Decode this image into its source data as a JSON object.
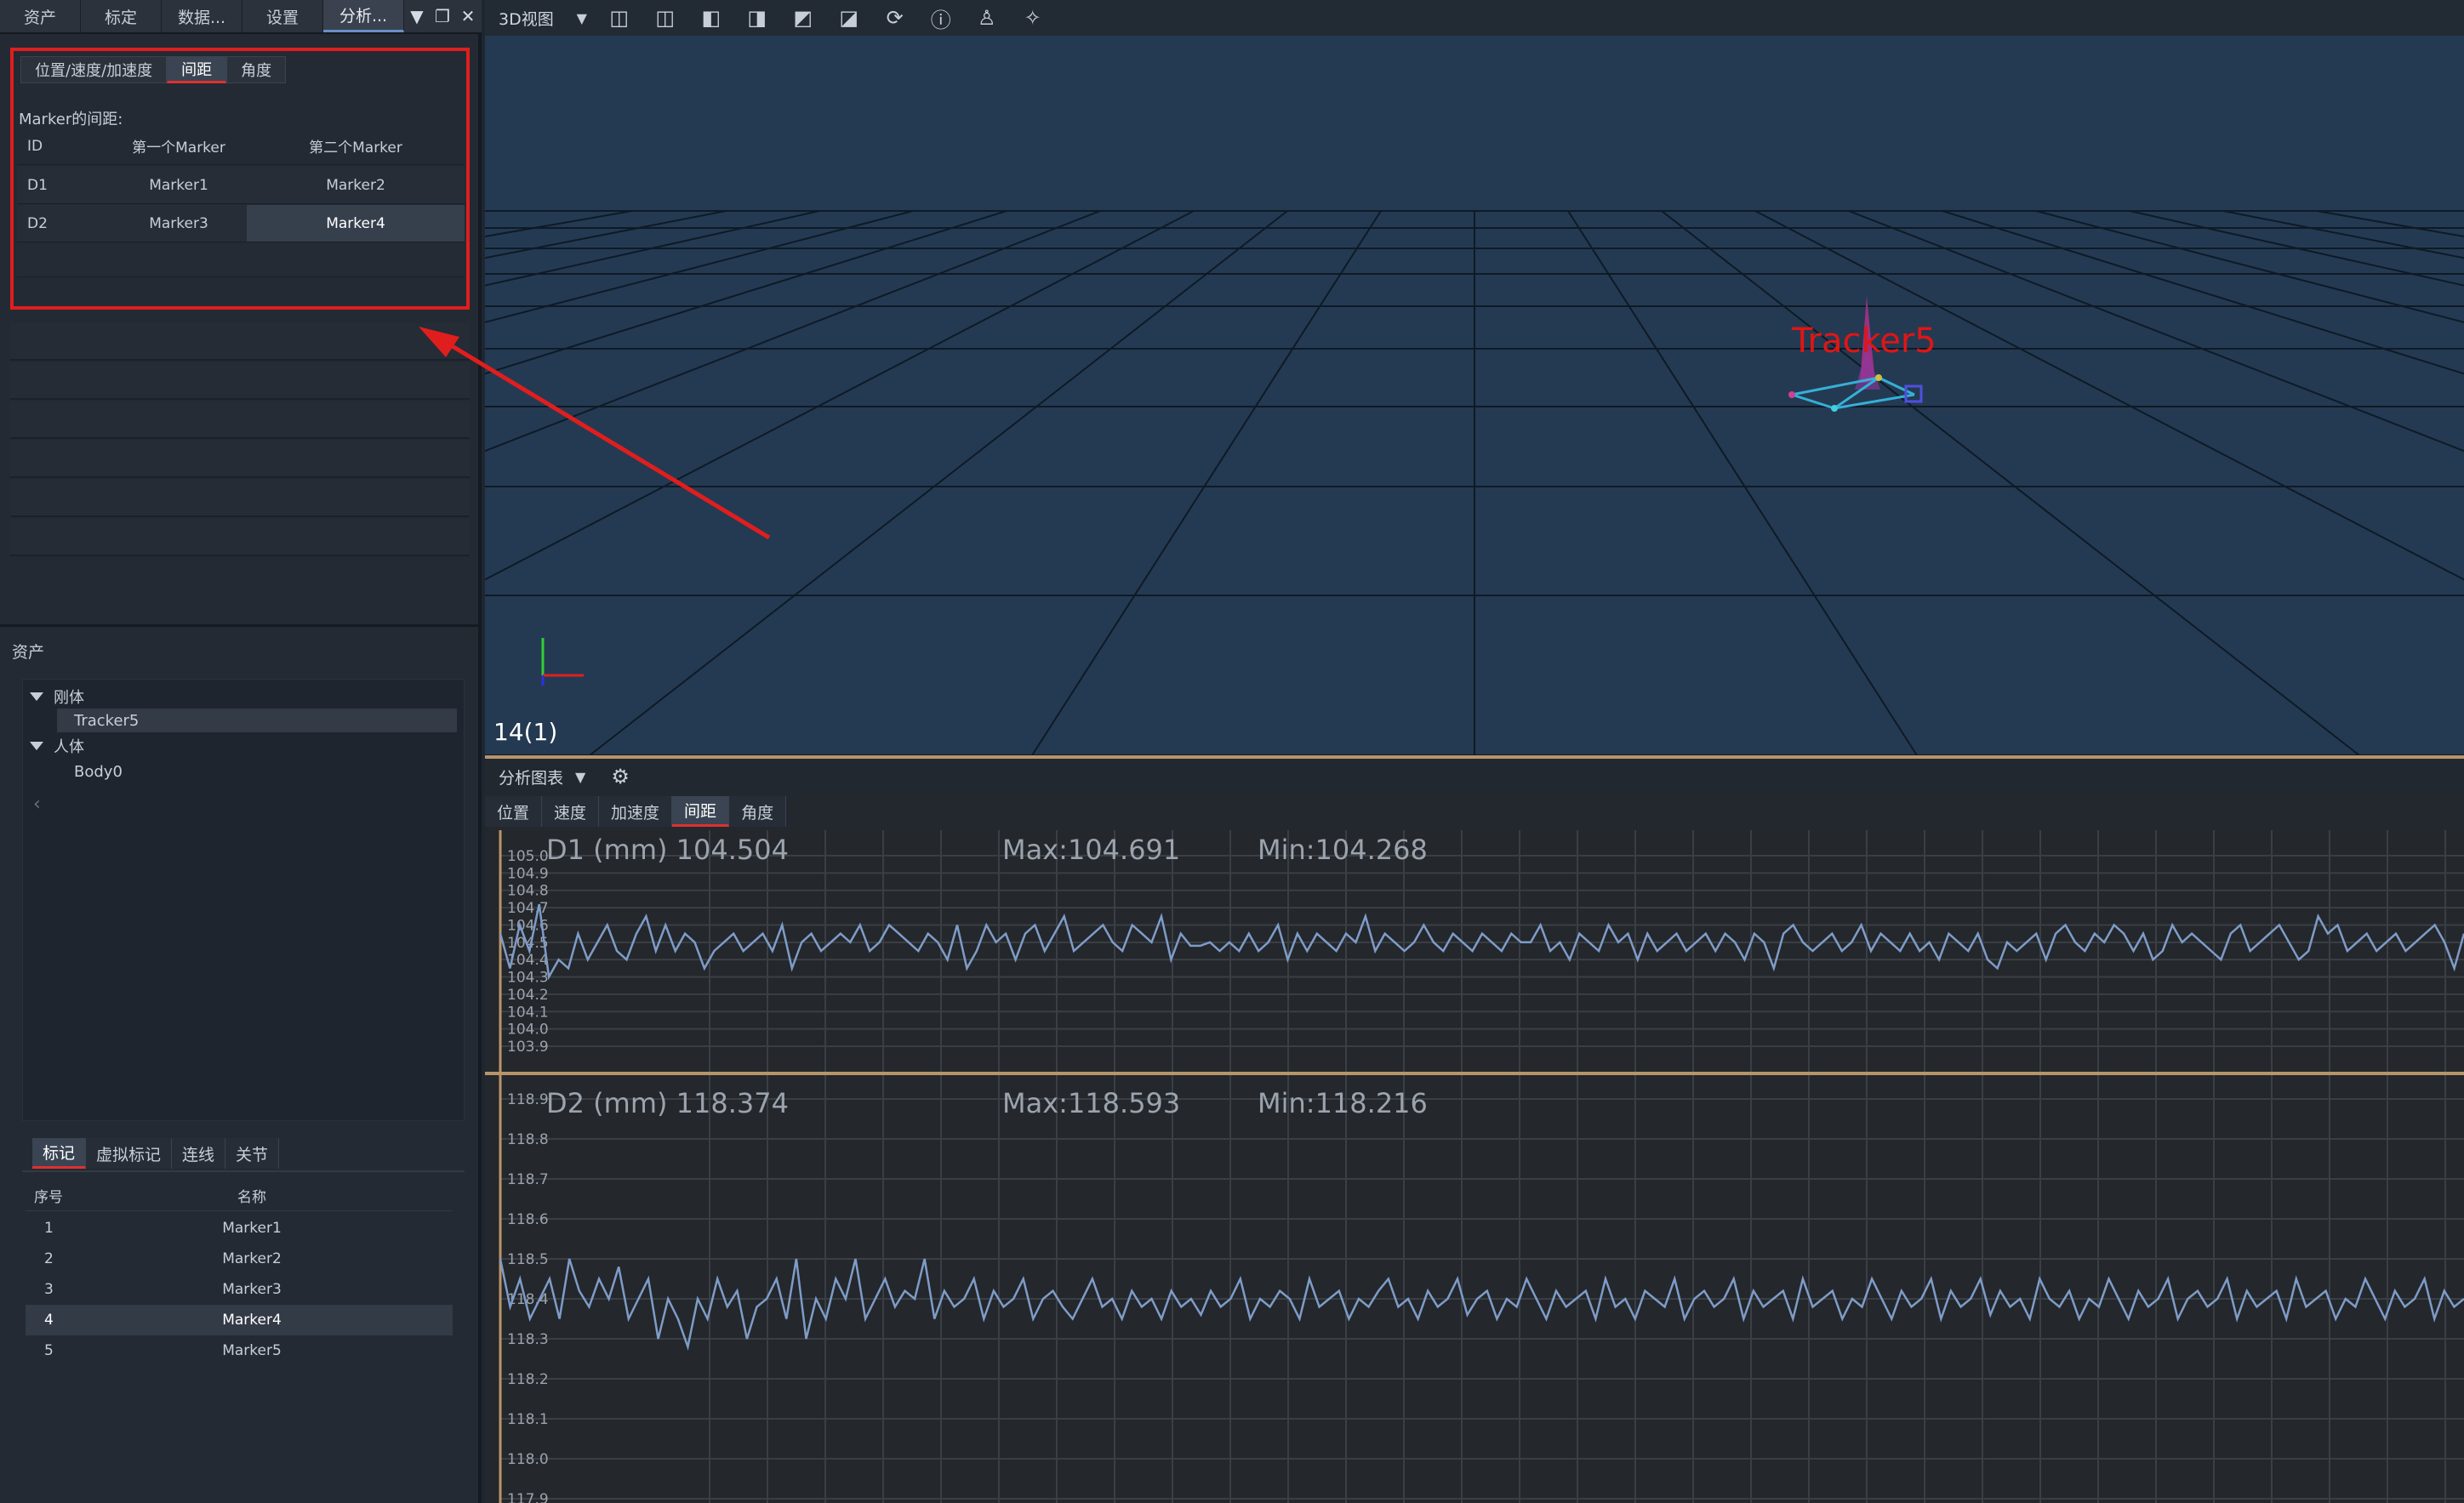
{
  "topTabs": [
    "资产",
    "标定",
    "数据...",
    "设置",
    "分析..."
  ],
  "analysis": {
    "tabs": [
      "位置/速度/加速度",
      "间距",
      "角度"
    ],
    "activeTab": 1,
    "label": "Marker的间距:",
    "headers": [
      "ID",
      "第一个Marker",
      "第二个Marker"
    ],
    "rows": [
      [
        "D1",
        "Marker1",
        "Marker2"
      ],
      [
        "D2",
        "Marker3",
        "Marker4"
      ]
    ]
  },
  "assets": {
    "title": "资产",
    "tree": {
      "rigid": "刚体",
      "rigidChild": "Tracker5",
      "human": "人体",
      "humanChild": "Body0"
    },
    "markerTabs": [
      "标记",
      "虚拟标记",
      "连线",
      "关节"
    ],
    "markerHeaders": [
      "序号",
      "名称"
    ],
    "markers": [
      [
        "1",
        "Marker1"
      ],
      [
        "2",
        "Marker2"
      ],
      [
        "3",
        "Marker3"
      ],
      [
        "4",
        "Marker4"
      ],
      [
        "5",
        "Marker5"
      ]
    ],
    "selectedMarker": 3
  },
  "viewport": {
    "viewLabel": "3D视图",
    "trackerLabel": "Tracker5",
    "frameLabel": "14(1)",
    "colors": {
      "background": "#243a52",
      "grid": "#0e1a26",
      "tracker": "#e01515"
    }
  },
  "chartPanel": {
    "title": "分析图表",
    "tabs": [
      "位置",
      "速度",
      "加速度",
      "间距",
      "角度"
    ],
    "activeTab": 3
  },
  "chart_data": [
    {
      "type": "line",
      "series": [
        {
          "name": "D1 (mm)",
          "values": [
            104.55,
            104.35,
            104.6,
            104.45,
            104.72,
            104.3,
            104.4,
            104.35,
            104.55,
            104.4,
            104.5,
            104.6,
            104.45,
            104.4,
            104.55,
            104.65,
            104.45,
            104.6,
            104.45,
            104.55,
            104.5,
            104.35,
            104.45,
            104.5,
            104.55,
            104.45,
            104.5,
            104.55,
            104.45,
            104.6,
            104.35,
            104.5,
            104.55,
            104.45,
            104.5,
            104.55,
            104.5,
            104.6,
            104.45,
            104.5,
            104.6,
            104.55,
            104.5,
            104.45,
            104.55,
            104.5,
            104.4,
            104.6,
            104.35,
            104.45,
            104.6,
            104.5,
            104.55,
            104.4,
            104.55,
            104.6,
            104.45,
            104.55,
            104.65,
            104.45,
            104.5,
            104.55,
            104.6,
            104.5,
            104.45,
            104.6,
            104.55,
            104.5,
            104.65,
            104.4,
            104.55,
            104.48,
            104.48,
            104.5,
            104.45,
            104.5,
            104.45,
            104.55,
            104.45,
            104.5,
            104.6,
            104.4,
            104.55,
            104.45,
            104.55,
            104.5,
            104.45,
            104.55,
            104.5,
            104.65,
            104.45,
            104.55,
            104.5,
            104.45,
            104.5,
            104.6,
            104.5,
            104.45,
            104.55,
            104.5,
            104.45,
            104.55,
            104.5,
            104.45,
            104.55,
            104.5,
            104.5,
            104.6,
            104.45,
            104.5,
            104.4,
            104.55,
            104.5,
            104.45,
            104.6,
            104.5,
            104.55,
            104.4,
            104.55,
            104.45,
            104.5,
            104.55,
            104.45,
            104.5,
            104.55,
            104.45,
            104.55,
            104.5,
            104.4,
            104.55,
            104.5,
            104.35,
            104.55,
            104.6,
            104.5,
            104.45,
            104.5,
            104.55,
            104.45,
            104.5,
            104.6,
            104.45,
            104.55,
            104.5,
            104.45,
            104.55,
            104.45,
            104.5,
            104.4,
            104.55,
            104.5,
            104.45,
            104.55,
            104.4,
            104.35,
            104.5,
            104.45,
            104.5,
            104.55,
            104.4,
            104.55,
            104.6,
            104.5,
            104.45,
            104.55,
            104.5,
            104.6,
            104.55,
            104.45,
            104.55,
            104.4,
            104.45,
            104.6,
            104.5,
            104.55,
            104.5,
            104.45,
            104.4,
            104.55,
            104.6,
            104.45,
            104.5,
            104.55,
            104.6,
            104.5,
            104.4,
            104.45,
            104.65,
            104.55,
            104.6,
            104.45,
            104.5,
            104.55,
            104.45,
            104.5,
            104.55,
            104.45,
            104.5,
            104.55,
            104.6,
            104.5,
            104.35,
            104.55
          ]
        }
      ],
      "readouts": {
        "current": "104.504",
        "max": "Max:104.691",
        "min": "Min:104.268"
      },
      "yTicks": [
        "105.0",
        "104.9",
        "104.8",
        "104.7",
        "104.6",
        "104.5",
        "104.4",
        "104.3",
        "104.2",
        "104.1",
        "104.0",
        "103.9"
      ],
      "ylim": [
        103.9,
        105.0
      ]
    },
    {
      "type": "line",
      "series": [
        {
          "name": "D2 (mm)",
          "values": [
            118.5,
            118.38,
            118.45,
            118.35,
            118.4,
            118.45,
            118.35,
            118.5,
            118.42,
            118.38,
            118.45,
            118.4,
            118.48,
            118.35,
            118.4,
            118.45,
            118.3,
            118.4,
            118.35,
            118.28,
            118.4,
            118.35,
            118.45,
            118.38,
            118.42,
            118.3,
            118.38,
            118.4,
            118.45,
            118.35,
            118.5,
            118.3,
            118.4,
            118.35,
            118.45,
            118.4,
            118.5,
            118.35,
            118.4,
            118.45,
            118.38,
            118.42,
            118.4,
            118.5,
            118.35,
            118.42,
            118.38,
            118.4,
            118.45,
            118.35,
            118.42,
            118.38,
            118.4,
            118.45,
            118.35,
            118.4,
            118.42,
            118.38,
            118.35,
            118.4,
            118.45,
            118.38,
            118.4,
            118.35,
            118.42,
            118.38,
            118.4,
            118.35,
            118.42,
            118.38,
            118.4,
            118.36,
            118.42,
            118.38,
            118.4,
            118.45,
            118.35,
            118.4,
            118.38,
            118.42,
            118.4,
            118.35,
            118.45,
            118.38,
            118.4,
            118.42,
            118.35,
            118.4,
            118.38,
            118.42,
            118.45,
            118.38,
            118.4,
            118.35,
            118.42,
            118.38,
            118.4,
            118.45,
            118.36,
            118.4,
            118.42,
            118.35,
            118.4,
            118.38,
            118.45,
            118.4,
            118.35,
            118.42,
            118.38,
            118.4,
            118.42,
            118.35,
            118.45,
            118.38,
            118.4,
            118.35,
            118.42,
            118.4,
            118.38,
            118.45,
            118.35,
            118.4,
            118.42,
            118.38,
            118.4,
            118.45,
            118.35,
            118.42,
            118.38,
            118.4,
            118.42,
            118.35,
            118.45,
            118.38,
            118.4,
            118.42,
            118.35,
            118.4,
            118.38,
            118.45,
            118.4,
            118.35,
            118.42,
            118.38,
            118.4,
            118.45,
            118.35,
            118.42,
            118.38,
            118.4,
            118.45,
            118.36,
            118.42,
            118.38,
            118.4,
            118.35,
            118.45,
            118.4,
            118.38,
            118.42,
            118.35,
            118.4,
            118.38,
            118.45,
            118.4,
            118.35,
            118.42,
            118.38,
            118.4,
            118.45,
            118.35,
            118.4,
            118.42,
            118.38,
            118.4,
            118.45,
            118.35,
            118.42,
            118.38,
            118.4,
            118.42,
            118.35,
            118.45,
            118.38,
            118.4,
            118.42,
            118.35,
            118.4,
            118.38,
            118.45,
            118.4,
            118.35,
            118.42,
            118.38,
            118.4,
            118.45,
            118.35,
            118.42,
            118.38,
            118.4
          ]
        }
      ],
      "readouts": {
        "current": "118.374",
        "max": "Max:118.593",
        "min": "Min:118.216"
      },
      "yTicks": [
        "118.9",
        "118.8",
        "118.7",
        "118.6",
        "118.5",
        "118.4",
        "118.3",
        "118.2",
        "118.1",
        "118.0",
        "117.9"
      ],
      "ylim": [
        117.9,
        118.9
      ]
    }
  ]
}
